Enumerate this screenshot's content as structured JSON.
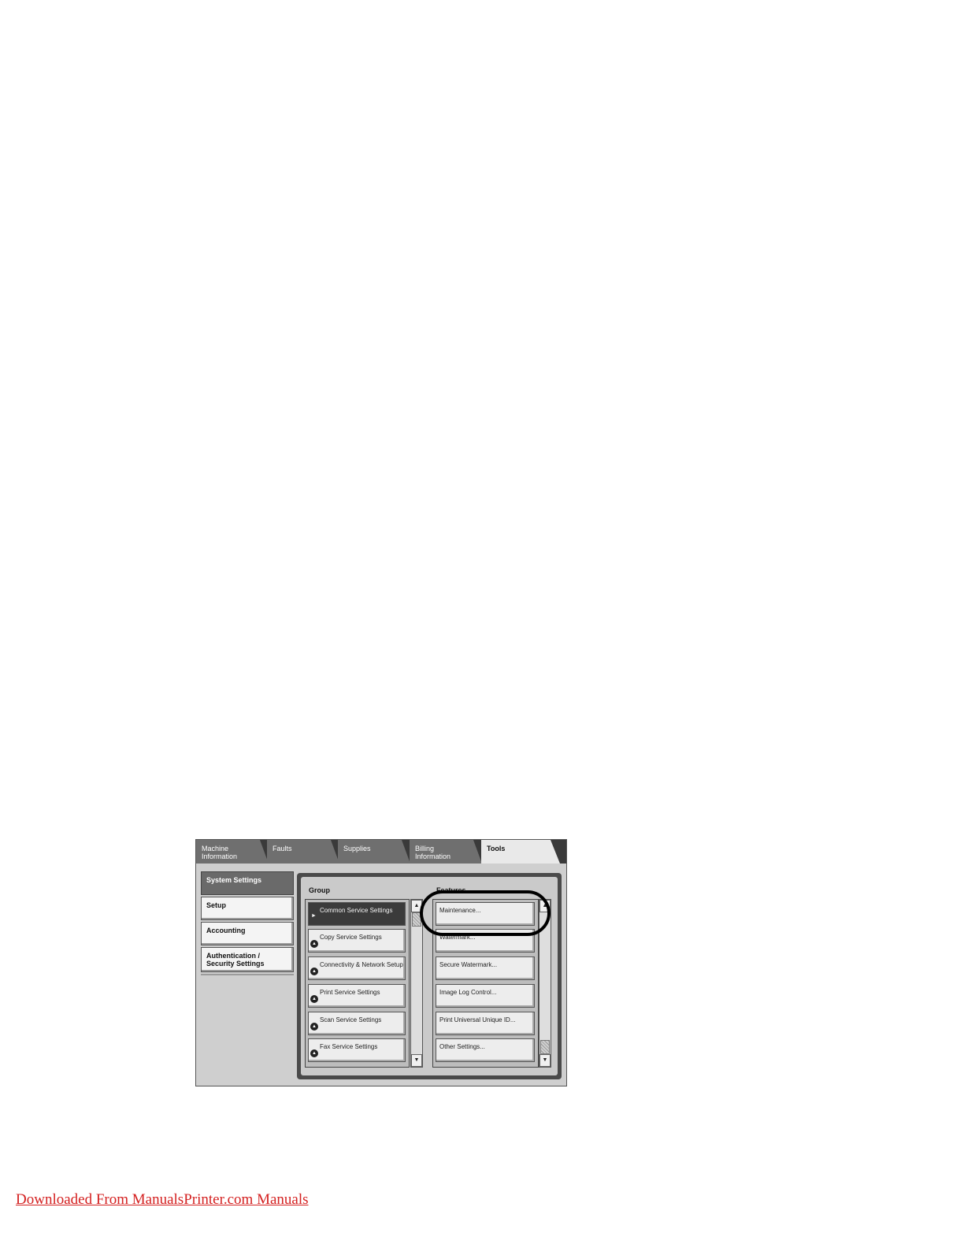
{
  "tabs": [
    {
      "label": "Machine\nInformation"
    },
    {
      "label": "Faults"
    },
    {
      "label": "Supplies"
    },
    {
      "label": "Billing\nInformation"
    },
    {
      "label": "Tools"
    }
  ],
  "sidebar": {
    "items": [
      {
        "label": "System Settings",
        "selected": true
      },
      {
        "label": "Setup"
      },
      {
        "label": "Accounting"
      },
      {
        "label": "Authentication /\nSecurity Settings"
      }
    ]
  },
  "group": {
    "header": "Group",
    "items": [
      {
        "label": "Common Service Settings",
        "selected": true
      },
      {
        "label": "Copy Service Settings"
      },
      {
        "label": "Connectivity & Network Setup"
      },
      {
        "label": "Print Service Settings"
      },
      {
        "label": "Scan Service Settings"
      },
      {
        "label": "Fax Service Settings"
      }
    ]
  },
  "features": {
    "header": "Features",
    "items": [
      {
        "label": "Maintenance..."
      },
      {
        "label": "Watermark..."
      },
      {
        "label": "Secure Watermark..."
      },
      {
        "label": "Image Log Control..."
      },
      {
        "label": "Print Universal Unique ID..."
      },
      {
        "label": "Other Settings..."
      }
    ]
  },
  "footer": {
    "link_text": "Downloaded From ManualsPrinter.com Manuals"
  },
  "colors": {
    "callout": "#000000",
    "link": "#d42020"
  }
}
